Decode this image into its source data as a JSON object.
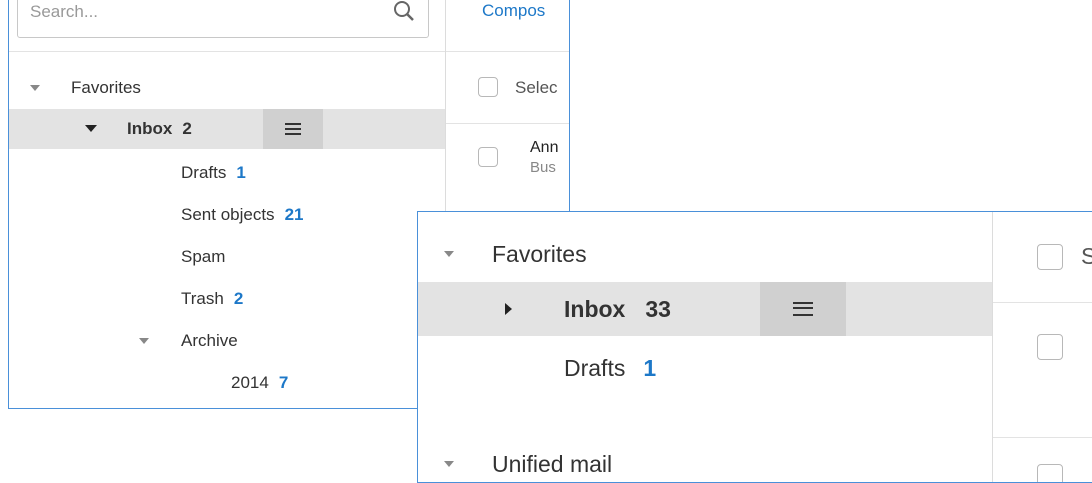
{
  "panel_small": {
    "search": {
      "placeholder": "Search..."
    },
    "compose_label": "Compos",
    "select_label": "Selec",
    "folders": {
      "favorites_label": "Favorites",
      "inbox": {
        "label": "Inbox",
        "count": "2"
      },
      "drafts": {
        "label": "Drafts",
        "count": "1"
      },
      "sent": {
        "label": "Sent objects",
        "count": "21"
      },
      "spam": {
        "label": "Spam"
      },
      "trash": {
        "label": "Trash",
        "count": "2"
      },
      "archive": {
        "label": "Archive"
      },
      "archive_2014": {
        "label": "2014",
        "count": "7"
      }
    },
    "message": {
      "sender": "Ann",
      "subject": "Bus"
    }
  },
  "panel_large": {
    "folders": {
      "favorites_label": "Favorites",
      "inbox": {
        "label": "Inbox",
        "count": "33"
      },
      "drafts": {
        "label": "Drafts",
        "count": "1"
      },
      "unified_label": "Unified mail"
    },
    "select_label": "S"
  },
  "colors": {
    "accent": "#1d78c8",
    "frame": "#4a90d9",
    "selected_bg": "#e3e3e3"
  },
  "icons": [
    "search-icon",
    "menu-icon",
    "chevron-down-icon",
    "chevron-right-icon"
  ]
}
